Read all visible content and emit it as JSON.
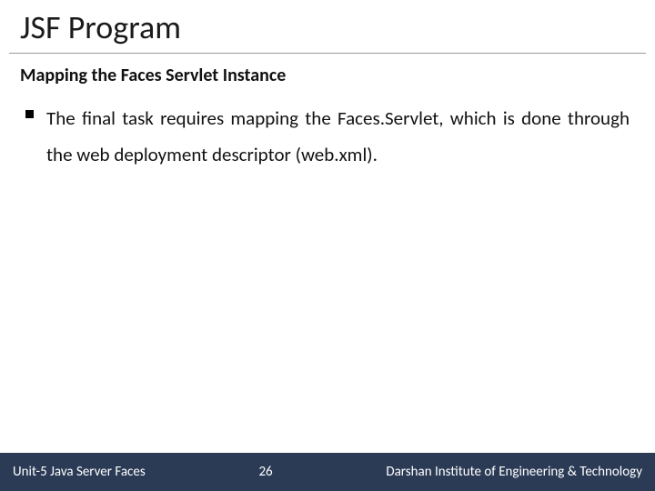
{
  "title": "JSF Program",
  "subtitle": "Mapping the Faces Servlet Instance",
  "bullets": [
    "The final task requires mapping the Faces.Servlet, which is done through the web deployment descriptor (web.xml)."
  ],
  "footer": {
    "left": "Unit-5 Java Server Faces",
    "page": "26",
    "right": "Darshan Institute of Engineering & Technology"
  }
}
